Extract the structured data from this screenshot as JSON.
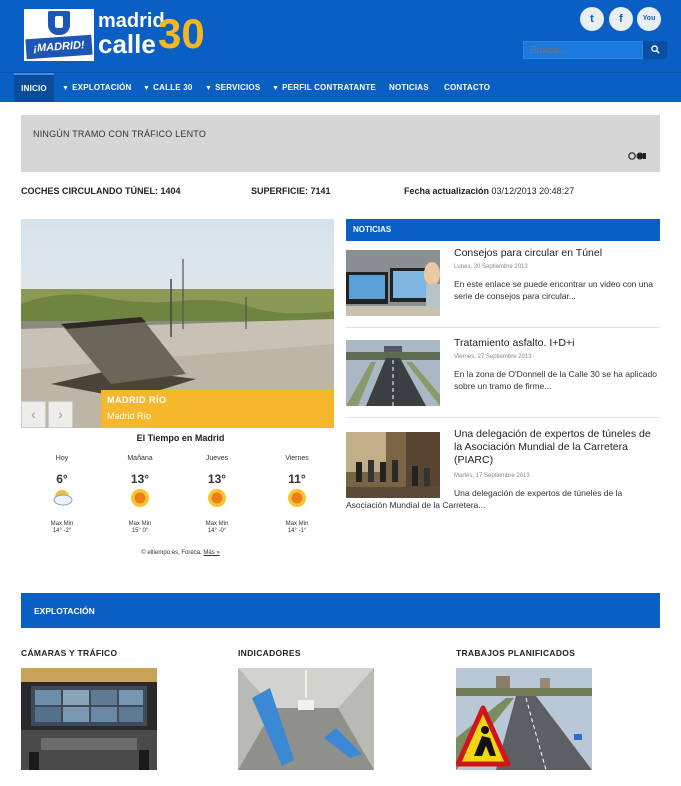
{
  "header": {
    "logo_text": "¡MADRID!",
    "brand_line1": "madrid",
    "brand_line2": "calle",
    "brand_number": "30",
    "social": [
      {
        "name": "twitter-icon",
        "glyph": "t"
      },
      {
        "name": "facebook-icon",
        "glyph": "f"
      },
      {
        "name": "youtube-icon",
        "glyph": "You"
      }
    ],
    "search_placeholder": "Buscar...",
    "search_button_icon": "search-icon"
  },
  "nav": {
    "items": [
      {
        "label": "INICIO",
        "active": true,
        "caret": false
      },
      {
        "label": "EXPLOTACIÓN",
        "caret": true
      },
      {
        "label": "CALLE 30",
        "caret": true
      },
      {
        "label": "SERVICIOS",
        "caret": true
      },
      {
        "label": "PERFIL CONTRATANTE",
        "caret": true
      },
      {
        "label": "NOTICIAS",
        "caret": false
      },
      {
        "label": "CONTACTO",
        "caret": false
      }
    ]
  },
  "traffic": {
    "message": "NINGÚN TRAMO CON TRÁFICO LENTO",
    "icon": "traffic-light-icon"
  },
  "stats": {
    "cars_label": "COCHES CIRCULANDO TÚNEL: 1404",
    "surface_label": "SUPERFICIE: 7141",
    "update_label": "Fecha actualización",
    "update_value": "03/12/2013 20:48:27"
  },
  "hero": {
    "caption_title": "MADRID RÍO",
    "caption_sub": "Madrid Río",
    "prev": "‹",
    "next": "›"
  },
  "weather": {
    "title": "El Tiempo en Madrid",
    "days": [
      {
        "day": "Hoy",
        "temp": "6°",
        "icon": "partly-cloudy-icon",
        "max": "14°",
        "min": "-2°"
      },
      {
        "day": "Mañana",
        "temp": "13°",
        "icon": "sun-icon",
        "max": "15°",
        "min": "0°"
      },
      {
        "day": "Jueves",
        "temp": "13°",
        "icon": "sun-icon",
        "max": "14°",
        "min": "-0°"
      },
      {
        "day": "Viernes",
        "temp": "11°",
        "icon": "sun-icon",
        "max": "14°",
        "min": "-1°"
      }
    ],
    "max_label": "Max",
    "min_label": "Min",
    "credit": "© eltiempo.es, Foreca.",
    "more_link": "Más »"
  },
  "news": {
    "header": "NOTICIAS",
    "items": [
      {
        "title": "Consejos para circular en Túnel",
        "date": "Lunes, 30 Septiembre 2013",
        "desc": "En este enlace se puede encontrar un video con una serie de consejos para circular..."
      },
      {
        "title": "Tratamiento asfalto. I+D+i",
        "date": "Viernes, 27 Septiembre 2013",
        "desc": "En la zona de O'Donnell de la Calle 30 se ha aplicado sobre un tramo de firme..."
      },
      {
        "title": "Una delegación de expertos de túneles de la Asociación Mundial de la Carretera (PIARC)",
        "date": "Martes, 17 Septiembre 2013",
        "desc": "Una delegación de expertos de túneles de la Asociación Mundial de la Carretera..."
      }
    ]
  },
  "explotacion": {
    "header": "EXPLOTACIÓN",
    "sections": [
      {
        "title": "CÁMARAS Y TRÁFICO"
      },
      {
        "title": "INDICADORES"
      },
      {
        "title": "TRABAJOS PLANIFICADOS"
      }
    ]
  }
}
